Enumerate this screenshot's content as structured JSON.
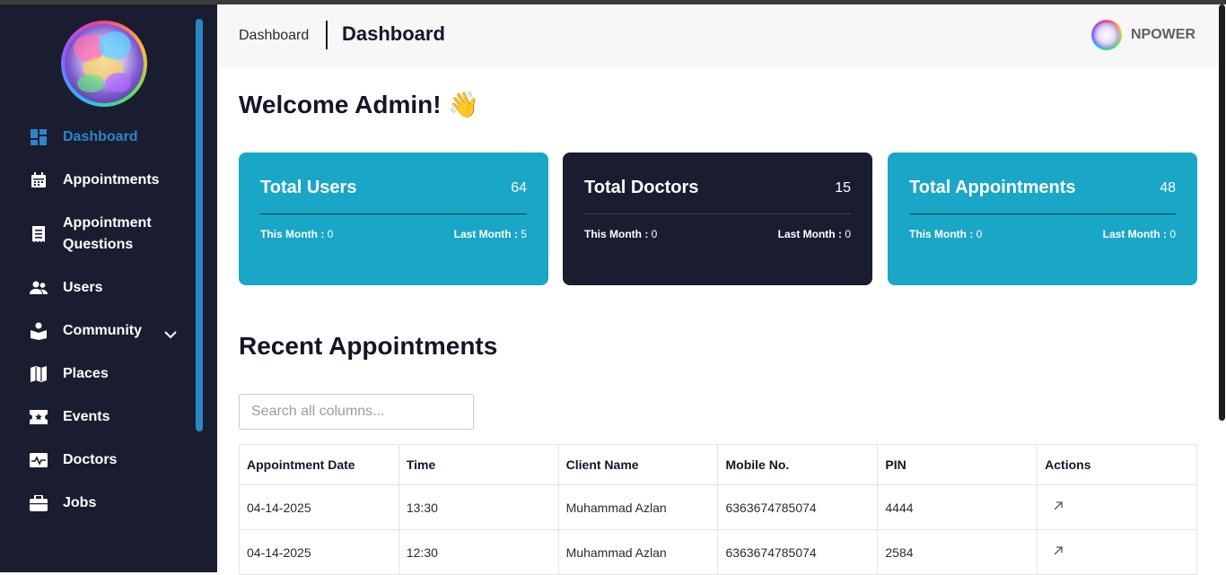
{
  "sidebar": {
    "items": [
      {
        "label": "Dashboard",
        "icon": "dashboard-icon",
        "active": true
      },
      {
        "label": "Appointments",
        "icon": "calendar-icon"
      },
      {
        "label": "Appointment",
        "label2": "Questions",
        "icon": "questions-icon"
      },
      {
        "label": "Users",
        "icon": "users-icon"
      },
      {
        "label": "Community",
        "icon": "community-icon",
        "has_submenu": true
      },
      {
        "label": "Places",
        "icon": "map-icon"
      },
      {
        "label": "Events",
        "icon": "ticket-icon"
      },
      {
        "label": "Doctors",
        "icon": "pulse-icon"
      },
      {
        "label": "Jobs",
        "icon": "briefcase-icon"
      }
    ]
  },
  "header": {
    "breadcrumb": "Dashboard",
    "title": "Dashboard",
    "user": "NPOWER"
  },
  "main": {
    "welcome": "Welcome Admin! 👋",
    "cards": [
      {
        "title": "Total Users",
        "count": "64",
        "this_month_label": "This Month :",
        "this_month": "0",
        "last_month_label": "Last Month :",
        "last_month": "5",
        "color": "#19a6c7"
      },
      {
        "title": "Total Doctors",
        "count": "15",
        "this_month_label": "This Month :",
        "this_month": "0",
        "last_month_label": "Last Month :",
        "last_month": "0",
        "color": "#1a1d30"
      },
      {
        "title": "Total Appointments",
        "count": "48",
        "this_month_label": "This Month :",
        "this_month": "0",
        "last_month_label": "Last Month :",
        "last_month": "0",
        "color": "#19a6c7"
      }
    ],
    "recent_title": "Recent Appointments",
    "search_placeholder": "Search all columns...",
    "table": {
      "columns": [
        "Appointment Date",
        "Time",
        "Client Name",
        "Mobile No.",
        "PIN",
        "Actions"
      ],
      "rows": [
        {
          "date": "04-14-2025",
          "time": "13:30",
          "client": "Muhammad Azlan",
          "mobile": "6363674785074",
          "pin": "4444",
          "action_icon": "open-external-icon"
        },
        {
          "date": "04-14-2025",
          "time": "12:30",
          "client": "Muhammad Azlan",
          "mobile": "6363674785074",
          "pin": "2584",
          "action_icon": "open-external-icon"
        }
      ]
    }
  },
  "colors": {
    "accent": "#2c86c5",
    "sidebar": "#1a1d30",
    "card_cyan": "#19a6c7"
  }
}
